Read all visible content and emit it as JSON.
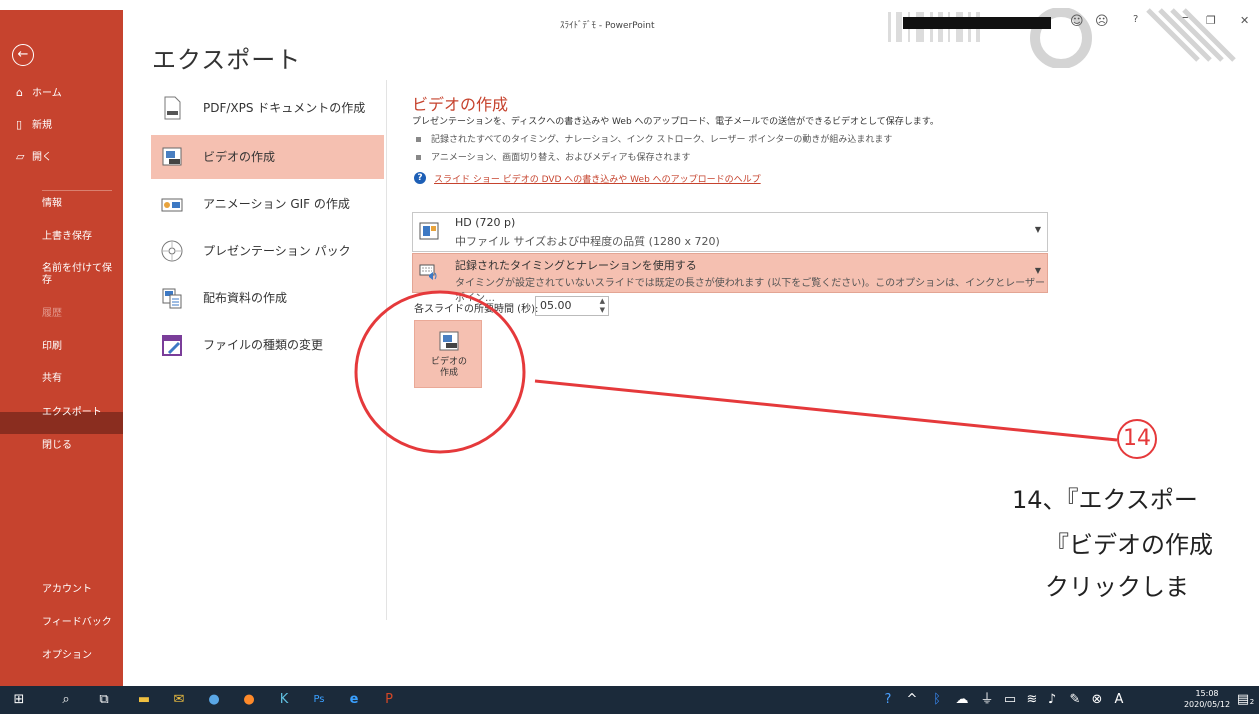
{
  "window": {
    "title": "ｽﾗｲﾄﾞﾃﾞﾓ - PowerPoint",
    "help_glyph": "?"
  },
  "sidebar": {
    "items_top": [
      {
        "label": "ホーム",
        "icon": "home-icon"
      },
      {
        "label": "新規",
        "icon": "new-doc-icon"
      },
      {
        "label": "開く",
        "icon": "folder-open-icon"
      }
    ],
    "items_main": [
      {
        "label": "情報"
      },
      {
        "label": "上書き保存"
      },
      {
        "label": "名前を付けて保\n存"
      },
      {
        "label": "履歴"
      },
      {
        "label": "印刷"
      },
      {
        "label": "共有"
      },
      {
        "label": "エクスポート"
      },
      {
        "label": "閉じる"
      }
    ],
    "items_bottom": [
      {
        "label": "アカウント"
      },
      {
        "label": "フィードバック"
      },
      {
        "label": "オプション"
      }
    ]
  },
  "page": {
    "title": "エクスポート"
  },
  "export_options": [
    {
      "label": "PDF/XPS ドキュメントの作成",
      "icon": "pdf-icon"
    },
    {
      "label": "ビデオの作成",
      "icon": "video-icon",
      "selected": true
    },
    {
      "label": "アニメーション GIF の作成",
      "icon": "gif-icon"
    },
    {
      "label": "プレゼンテーション パック",
      "icon": "cd-icon"
    },
    {
      "label": "配布資料の作成",
      "icon": "handout-icon"
    },
    {
      "label": "ファイルの種類の変更",
      "icon": "file-type-icon"
    }
  ],
  "video_panel": {
    "title": "ビデオの作成",
    "description": "プレゼンテーションを、ディスクへの書き込みや Web へのアップロード、電子メールでの送信ができるビデオとして保存します。",
    "bullets": [
      "記録されたすべてのタイミング、ナレーション、インク ストローク、レーザー ポインターの動きが組み込まれます",
      "アニメーション、画面切り替え、およびメディアも保存されます"
    ],
    "help_link": "スライド ショー ビデオの DVD への書き込みや Web へのアップロードのヘルプ",
    "quality": {
      "line1": "HD (720 p)",
      "line2": "中ファイル サイズおよび中程度の品質 (1280 x 720)"
    },
    "timing": {
      "line1": "記録されたタイミングとナレーションを使用する",
      "line2": "タイミングが設定されていないスライドでは既定の長さが使われます (以下をご覧ください)。このオプションは、インクとレーザー ポイン…"
    },
    "duration_label": "各スライドの所要時間 (秒):",
    "duration_value": "05.00",
    "create_button": "ビデオの\n作成"
  },
  "annotation": {
    "step_number": "14",
    "line1": "14、『エクスポー",
    "line2": "『ビデオの作成",
    "line3": "クリックしま",
    "color": "#e5393b"
  },
  "taskbar": {
    "time": "15:08",
    "date": "2020/05/12",
    "notification_count": "2"
  },
  "colors": {
    "accent": "#c6432e",
    "selected": "#f5c0b1",
    "taskbar": "#1b2a3a"
  }
}
